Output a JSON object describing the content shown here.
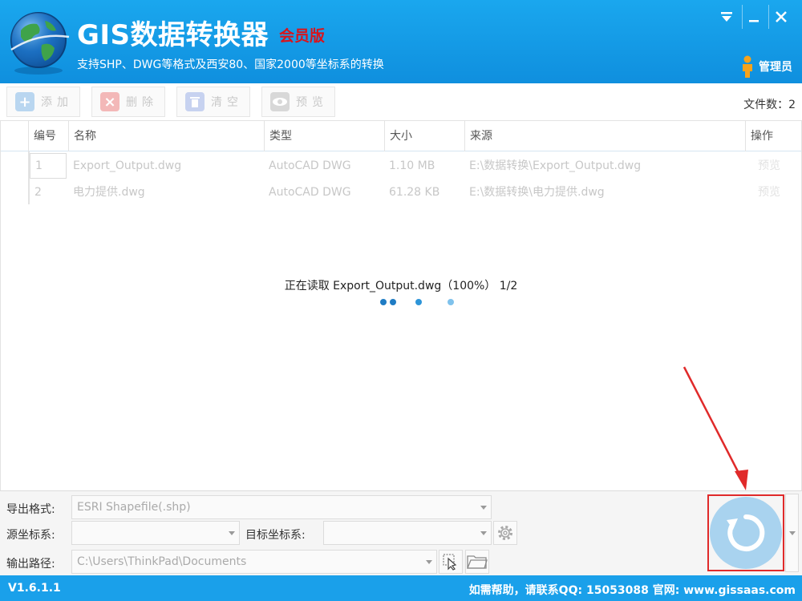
{
  "app": {
    "title": "GIS数据转换器",
    "badge": "会员版",
    "subtitle": "支持SHP、DWG等格式及西安80、国家2000等坐标系的转换",
    "user": "管理员"
  },
  "toolbar": {
    "add": "添加",
    "delete": "删除",
    "clear": "清空",
    "preview": "预览",
    "file_count": "文件数：2"
  },
  "table": {
    "headers": [
      "编号",
      "名称",
      "类型",
      "大小",
      "来源",
      "操作"
    ],
    "rows": [
      {
        "id": "1",
        "name": "Export_Output.dwg",
        "type": "AutoCAD DWG",
        "size": "1.10 MB",
        "source": "E:\\数据转换\\Export_Output.dwg",
        "action": "预览"
      },
      {
        "id": "2",
        "name": "电力提供.dwg",
        "type": "AutoCAD DWG",
        "size": "61.28 KB",
        "source": "E:\\数据转换\\电力提供.dwg",
        "action": "预览"
      }
    ]
  },
  "loading": {
    "text": "正在读取 Export_Output.dwg（100%） 1/2"
  },
  "panel": {
    "export_label": "导出格式:",
    "export_value": "ESRI Shapefile(.shp)",
    "src_crs_label": "源坐标系:",
    "src_crs_value": "",
    "dst_crs_label": "目标坐标系:",
    "dst_crs_value": "",
    "output_label": "输出路径:",
    "output_value": "C:\\Users\\ThinkPad\\Documents"
  },
  "status": {
    "version": "V1.6.1.1",
    "help": "如需帮助，请联系QQ:   15053088   官网:   www.gissaas.com"
  },
  "colors": {
    "brand": "#1aa0ea",
    "badge": "#d8141c",
    "highlight": "#e02a2a",
    "run_button": "#a9d3ef"
  }
}
